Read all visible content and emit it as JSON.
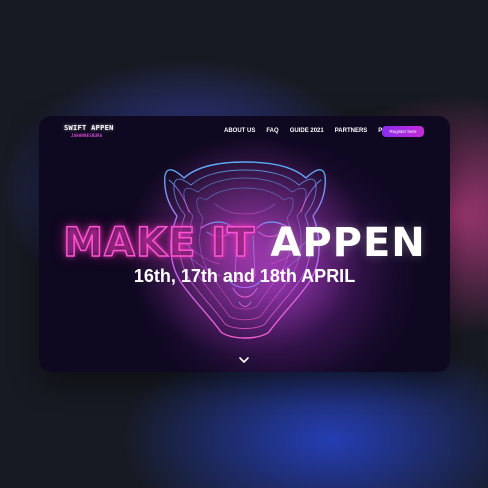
{
  "brand": {
    "name": "SWIFT APPEN",
    "tagline": "JOHANNESBURG"
  },
  "nav": {
    "items": [
      "ABOUT US",
      "FAQ",
      "GUIDE 2021",
      "PARTNERS",
      "PAST"
    ],
    "register_label": "Register here"
  },
  "hero": {
    "headline_outline": "MAKE IT",
    "headline_solid": "APPEN",
    "dates": "16th, 17th and 18th APRIL"
  },
  "icons": {
    "scroll": "chevron-down-icon",
    "background": "tiger-face-icon"
  },
  "colors": {
    "accent": "#c42bd6",
    "neon_pink": "#ff55d4",
    "card_bg": "#160a2a"
  }
}
